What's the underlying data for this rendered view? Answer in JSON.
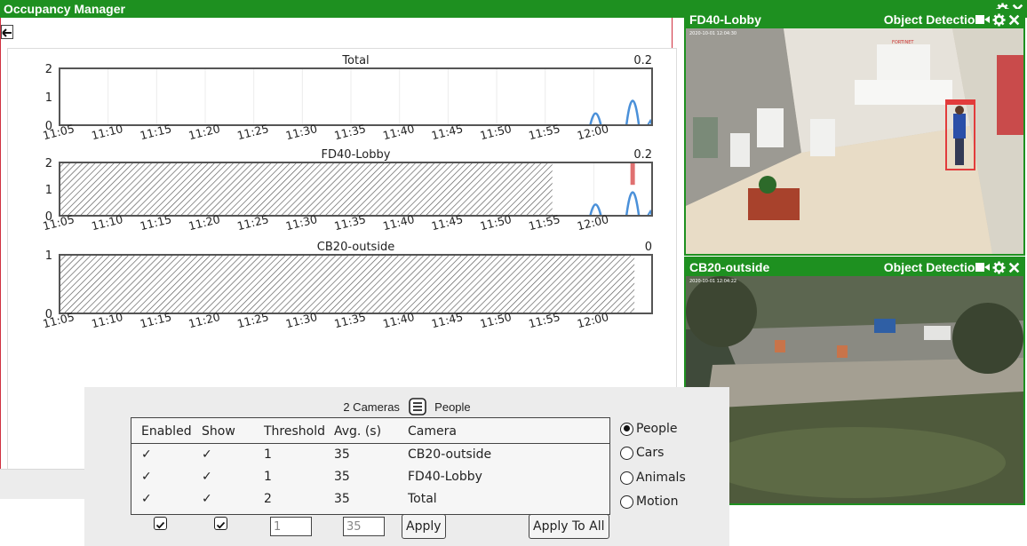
{
  "colors": {
    "titlebar": "#1e9020",
    "accent_red": "#d03040",
    "series_blue": "#4a90d9",
    "series_red": "#e07070"
  },
  "occupancy": {
    "title": "Occupancy Manager",
    "charts": [
      {
        "title": "Total",
        "value_label": "0.2",
        "y_ticks": [
          "2",
          "1",
          "0"
        ],
        "hatch_until": null,
        "red_spike": false,
        "ymax": 2
      },
      {
        "title": "FD40-Lobby",
        "value_label": "0.2",
        "y_ticks": [
          "2",
          "1",
          "0"
        ],
        "hatch_until": "11:55",
        "red_spike": true,
        "ymax": 2
      },
      {
        "title": "CB20-outside",
        "value_label": "0",
        "y_ticks": [
          "1",
          "0"
        ],
        "hatch_until": "12:04",
        "red_spike": false,
        "ymax": 1
      }
    ],
    "x_ticks": [
      "11:05",
      "11:10",
      "11:15",
      "11:20",
      "11:25",
      "11:30",
      "11:35",
      "11:40",
      "11:45",
      "11:50",
      "11:55",
      "12:00"
    ]
  },
  "cameras": [
    {
      "name": "FD40-Lobby",
      "mode": "Object Detection",
      "timestamp": "2020-10-01 12:04:30"
    },
    {
      "name": "CB20-outside",
      "mode": "Object Detection",
      "timestamp": "2020-10-01 12:04:22"
    }
  ],
  "settings": {
    "camera_count": "2 Cameras",
    "selected_type": "People",
    "columns": [
      "Enabled",
      "Show",
      "Threshold",
      "Avg. (s)",
      "Camera"
    ],
    "rows": [
      {
        "enabled": "✓",
        "show": "✓",
        "threshold": "1",
        "avg": "35",
        "camera": "CB20-outside"
      },
      {
        "enabled": "✓",
        "show": "✓",
        "threshold": "1",
        "avg": "35",
        "camera": "FD40-Lobby"
      },
      {
        "enabled": "✓",
        "show": "✓",
        "threshold": "2",
        "avg": "35",
        "camera": "Total"
      }
    ],
    "radio_options": [
      "People",
      "Cars",
      "Animals",
      "Motion"
    ],
    "threshold_value": "1",
    "avg_value": "35",
    "apply_label": "Apply",
    "apply_all_label": "Apply To All"
  }
}
